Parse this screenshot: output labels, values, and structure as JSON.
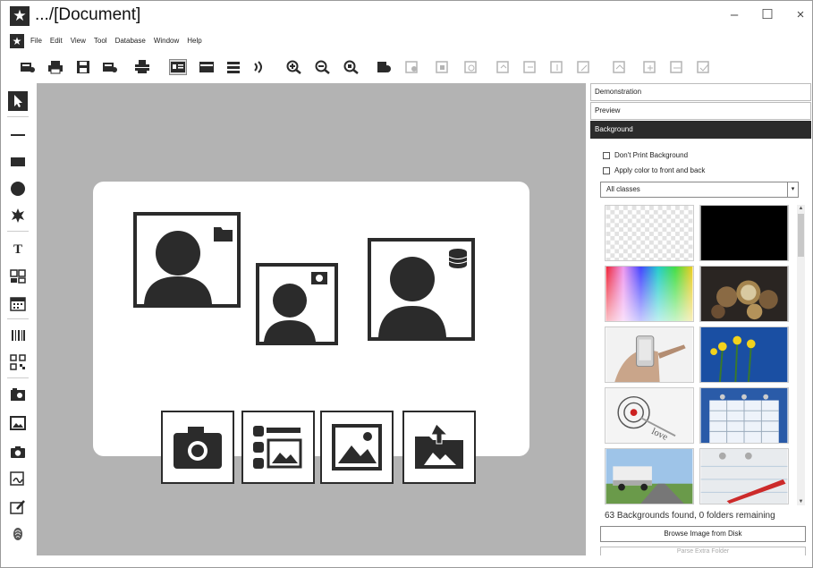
{
  "window": {
    "title": ".../[Document]",
    "controls": {
      "minimize": "–",
      "maximize": "☐",
      "close": "×"
    }
  },
  "menu": {
    "items": [
      "File",
      "Edit",
      "View",
      "Tool",
      "Database",
      "Window",
      "Help"
    ]
  },
  "toolbar": {
    "icons": [
      "print-preview-icon",
      "print-icon",
      "save-icon",
      "print-setup-icon",
      "printer-icon",
      "card-view-icon",
      "card-single-icon",
      "list-view-icon",
      "sound-icon",
      "zoom-in-icon",
      "zoom-out-icon",
      "zoom-fit-icon",
      "layer-icon",
      "align-icon",
      "align-icon",
      "align-icon",
      "align-icon",
      "align-icon",
      "align-icon",
      "align-icon",
      "align-icon",
      "align-icon",
      "align-icon",
      "align-icon"
    ]
  },
  "palette": {
    "tools": [
      "select-arrow-icon",
      "line-tool-icon",
      "rectangle-tool-icon",
      "ellipse-tool-icon",
      "star-tool-icon",
      "text-tool-icon",
      "barcode-tool-icon",
      "calendar-tool-icon",
      "barcode-1d-tool-icon",
      "qr-code-tool-icon",
      "photo-capture-tool-icon",
      "image-tool-icon",
      "camera-tool-icon",
      "signature-tool-icon",
      "edit-tool-icon",
      "fingerprint-tool-icon"
    ]
  },
  "panel": {
    "tabs": [
      "Demonstration",
      "Preview",
      "Background"
    ],
    "active_tab": "Background",
    "checkboxes": [
      "Don't Print Background",
      "Apply color to front and back"
    ],
    "class_select": "All classes",
    "found_text": "63 Backgrounds found, 0 folders remaining",
    "browse_button": "Browse Image from Disk",
    "next_button": "Parse Extra Folder"
  },
  "colors": {
    "dark": "#2b2b2b",
    "canvas": "#b3b3b3",
    "accent_blue": "#1a4fa3"
  }
}
